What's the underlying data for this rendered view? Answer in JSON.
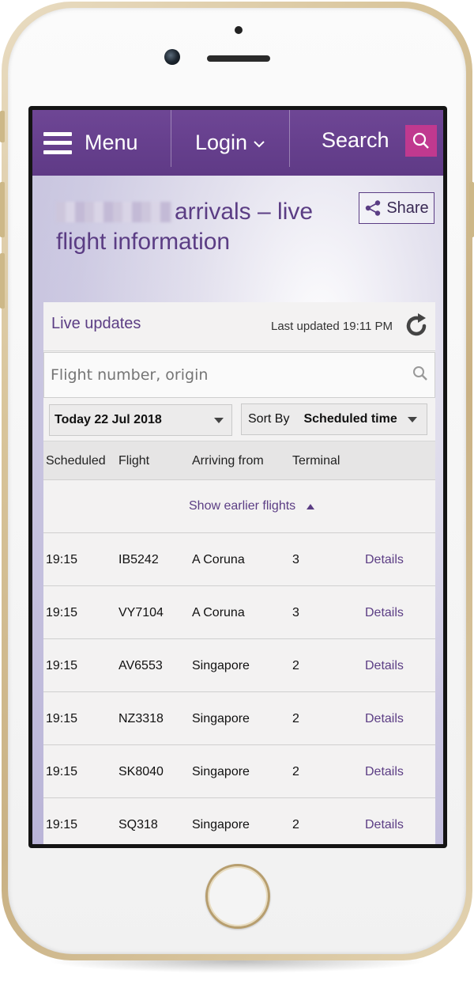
{
  "nav": {
    "menu_label": "Menu",
    "login_label": "Login",
    "search_label": "Search"
  },
  "page": {
    "title_line1": "arrivals – live",
    "title_line2": "flight information",
    "share_label": "Share"
  },
  "panel": {
    "live_updates": "Live updates",
    "last_updated": "Last updated 19:11 PM"
  },
  "search": {
    "placeholder": "Flight number, origin"
  },
  "filters": {
    "date_value": "Today 22 Jul 2018",
    "sort_prefix": "Sort By",
    "sort_value": "Scheduled time"
  },
  "table": {
    "headers": [
      "Scheduled",
      "Flight",
      "Arriving from",
      "Terminal"
    ],
    "show_earlier": "Show earlier flights",
    "rows": [
      {
        "time": "19:15",
        "flight": "IB5242",
        "from": "A Coruna",
        "terminal": "3",
        "action": "Details"
      },
      {
        "time": "19:15",
        "flight": "VY7104",
        "from": "A Coruna",
        "terminal": "3",
        "action": "Details"
      },
      {
        "time": "19:15",
        "flight": "AV6553",
        "from": "Singapore",
        "terminal": "2",
        "action": "Details"
      },
      {
        "time": "19:15",
        "flight": "NZ3318",
        "from": "Singapore",
        "terminal": "2",
        "action": "Details"
      },
      {
        "time": "19:15",
        "flight": "SK8040",
        "from": "Singapore",
        "terminal": "2",
        "action": "Details"
      },
      {
        "time": "19:15",
        "flight": "SQ318",
        "from": "Singapore",
        "terminal": "2",
        "action": "Details"
      }
    ]
  },
  "colors": {
    "brand_purple": "#5f3a86",
    "accent_magenta": "#c0398f"
  }
}
